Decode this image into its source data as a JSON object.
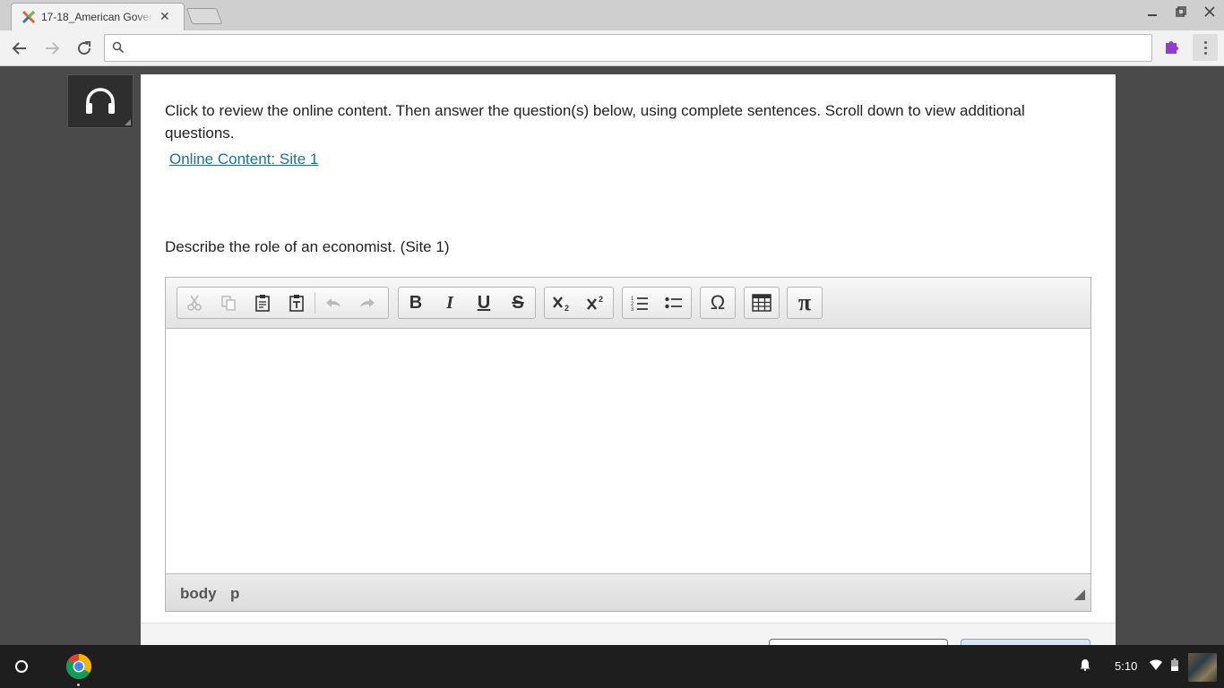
{
  "browser": {
    "tab_title": "17-18_American Govern",
    "tab_close": "✕",
    "favicon": "edgenuity-x-icon",
    "address_placeholder": "",
    "window_controls": [
      "minimize-icon",
      "restore-icon",
      "close-icon"
    ]
  },
  "page": {
    "instructions": "Click to review the online content. Then answer the question(s) below, using complete sentences. Scroll down to view additional questions.",
    "link_label": "Online Content: Site 1",
    "question": "Describe the role of an economist. (Site 1)",
    "link_color": "#1f6f99"
  },
  "editor": {
    "toolbar_groups": [
      [
        "cut-icon",
        "copy-icon",
        "paste-icon",
        "paste-text-icon",
        "undo-icon",
        "redo-icon"
      ],
      [
        "bold-icon",
        "italic-icon",
        "underline-icon",
        "strikethrough-icon"
      ],
      [
        "subscript-icon",
        "superscript-icon"
      ],
      [
        "numbered-list-icon",
        "bulleted-list-icon"
      ],
      [
        "special-character-icon"
      ],
      [
        "table-icon"
      ],
      [
        "math-pi-icon"
      ]
    ],
    "labels": {
      "bold": "B",
      "italic": "I",
      "underline": "U",
      "strike": "S",
      "omega": "Ω",
      "pi": "π"
    },
    "content": "",
    "path": [
      "body",
      "p"
    ]
  },
  "taskbar": {
    "time": "5:10"
  }
}
